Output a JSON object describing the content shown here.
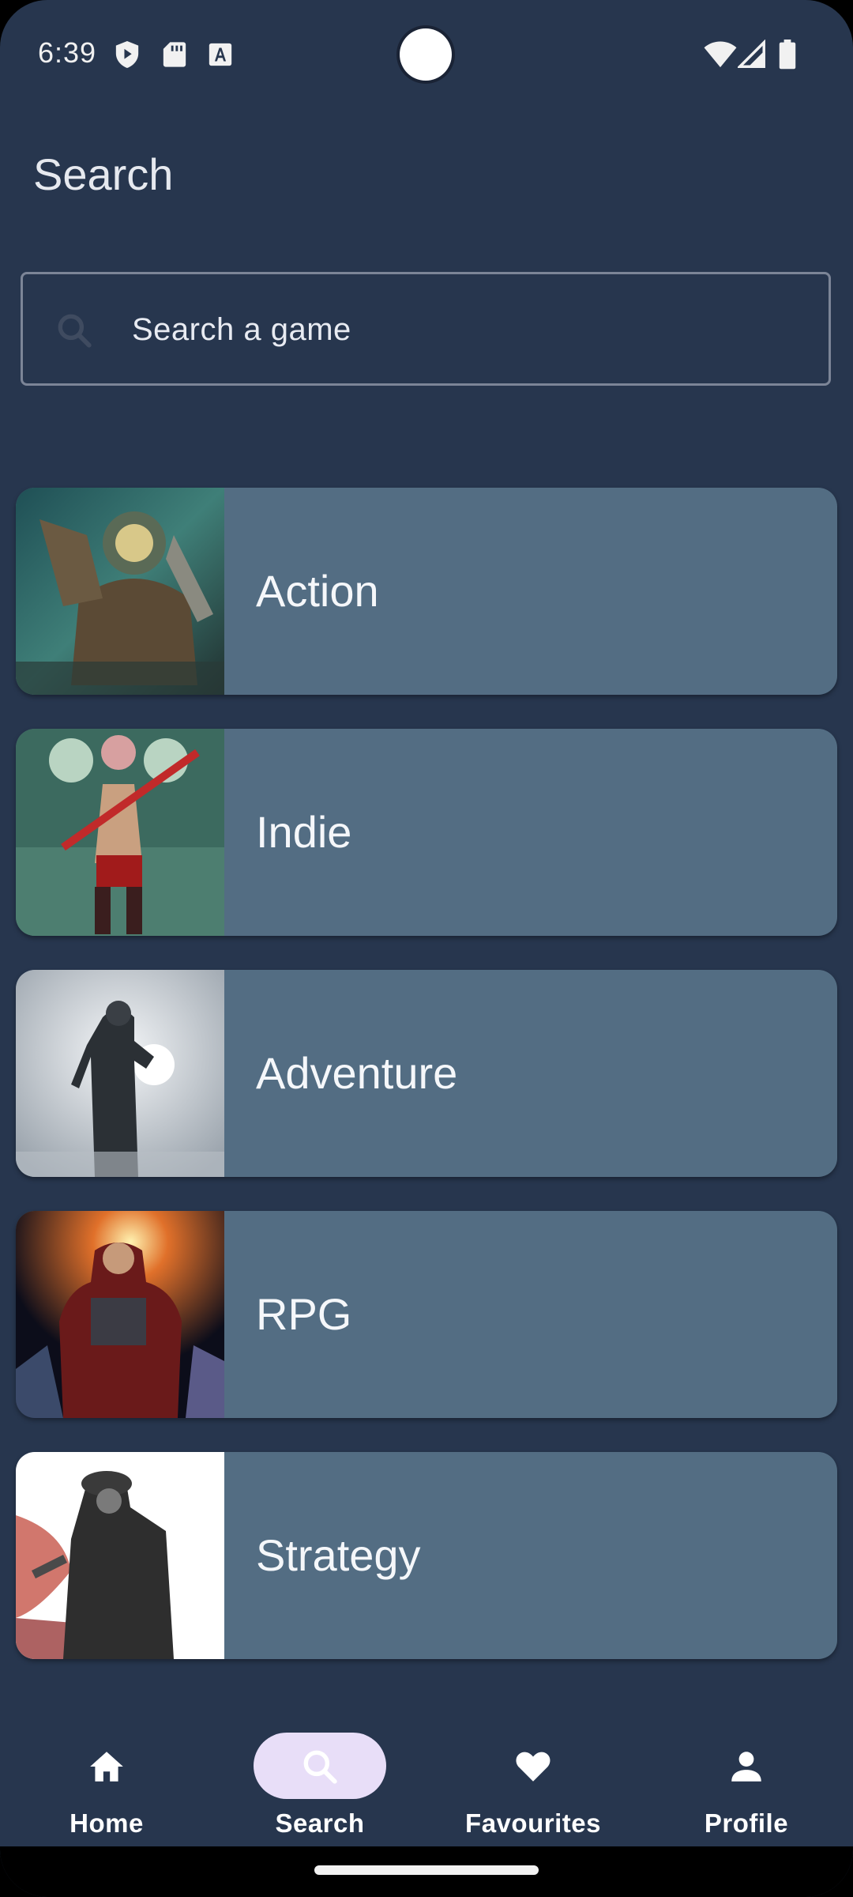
{
  "status_bar": {
    "time": "6:39",
    "left_icons": [
      "shield-play-icon",
      "sd-card-icon",
      "font-a-icon"
    ],
    "right_icons": [
      "wifi-icon",
      "cell-signal-icon",
      "battery-icon"
    ]
  },
  "page": {
    "title": "Search"
  },
  "search": {
    "icon": "search-icon",
    "placeholder": "Search a game",
    "value": ""
  },
  "categories": [
    {
      "label": "Action",
      "thumbnail": "action-game-art"
    },
    {
      "label": "Indie",
      "thumbnail": "indie-game-art"
    },
    {
      "label": "Adventure",
      "thumbnail": "adventure-game-art"
    },
    {
      "label": "RPG",
      "thumbnail": "rpg-game-art"
    },
    {
      "label": "Strategy",
      "thumbnail": "strategy-game-art"
    }
  ],
  "bottom_nav": {
    "items": [
      {
        "label": "Home",
        "icon": "home-icon",
        "active": false
      },
      {
        "label": "Search",
        "icon": "search-icon",
        "active": true
      },
      {
        "label": "Favourites",
        "icon": "heart-icon",
        "active": false
      },
      {
        "label": "Profile",
        "icon": "person-icon",
        "active": false
      }
    ]
  },
  "colors": {
    "background": "#27364e",
    "card": "#536d83",
    "active_pill": "#e8def8"
  }
}
